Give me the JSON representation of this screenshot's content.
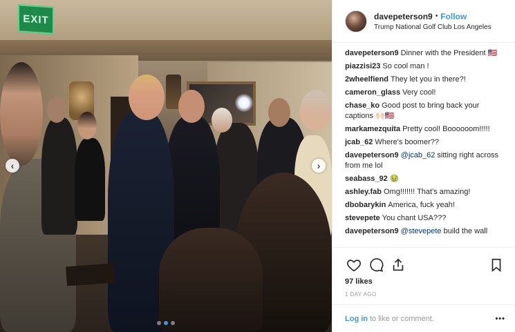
{
  "photo": {
    "exit_sign": "EXIT",
    "nav_prev_glyph": "‹",
    "nav_next_glyph": "›",
    "dots_count": 3,
    "active_dot": 1
  },
  "post": {
    "author": "davepeterson9",
    "follow_label": "Follow",
    "separator": "•",
    "location": "Trump National Golf Club Los Angeles",
    "caption": "Dinner with the President 🇺🇸"
  },
  "comments": [
    {
      "user": "piazzisi23",
      "text": "So cool man !"
    },
    {
      "user": "2wheelfiend",
      "text": "They let you in there?!"
    },
    {
      "user": "cameron_glass",
      "text": "Very cool!"
    },
    {
      "user": "chase_ko",
      "text": "Good post to bring back your captions 🙌🏻🇺🇸"
    },
    {
      "user": "markamezquita",
      "text": "Pretty cool! Boooooom!!!!!"
    },
    {
      "user": "jcab_62",
      "text": "Where's boomer??"
    },
    {
      "user": "davepeterson9",
      "mention": "@jcab_62",
      "text": " sitting right across from me lol"
    },
    {
      "user": "seabass_92",
      "text": "🤢"
    },
    {
      "user": "ashley.fab",
      "text": "Omg!!!!!!! That's amazing!"
    },
    {
      "user": "dbobarykin",
      "text": "America, fuck yeah!"
    },
    {
      "user": "stevepete",
      "text": "You chant USA???"
    },
    {
      "user": "davepeterson9",
      "mention": "@stevepete",
      "text": " build the wall"
    }
  ],
  "actions": {
    "icons": [
      "heart-icon",
      "comment-icon",
      "share-icon",
      "bookmark-icon"
    ]
  },
  "likes": "97 likes",
  "time_ago": "1 DAY AGO",
  "footer": {
    "login_label": "Log in",
    "login_suffix": "to like or comment.",
    "more_glyph": "•••"
  },
  "colors": {
    "accent": "#3897f0",
    "text": "#262626",
    "muted": "#999999",
    "divider": "#efefef"
  }
}
